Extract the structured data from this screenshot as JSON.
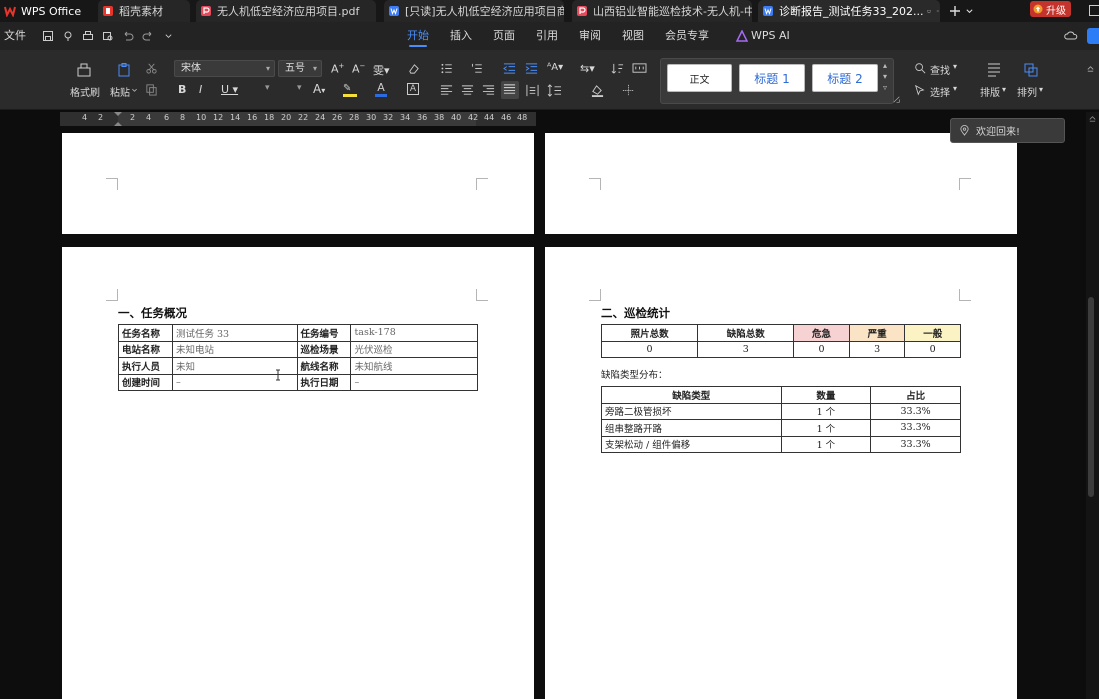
{
  "app": {
    "name": "WPS Office"
  },
  "tabs": [
    {
      "label": "WPS Office",
      "type": "wps"
    },
    {
      "label": "稻壳素材",
      "type": "docer"
    },
    {
      "label": "无人机低空经济应用项目.pdf",
      "type": "pdf"
    },
    {
      "label": "[只读]无人机低空经济应用项目商...",
      "type": "word"
    },
    {
      "label": "山西铝业智能巡检技术-无人机-中...",
      "type": "pdf"
    },
    {
      "label": "诊断报告_测试任务33_202...",
      "type": "word",
      "active": true
    }
  ],
  "upgrade_label": "升级",
  "menu": {
    "file": "文件",
    "items": [
      "开始",
      "插入",
      "页面",
      "引用",
      "审阅",
      "视图",
      "会员专享"
    ],
    "active": "开始",
    "ai": "WPS AI"
  },
  "ribbon": {
    "format_painter": "格式刷",
    "paste": "粘贴",
    "font_name": "宋体",
    "font_size": "五号",
    "styles": [
      "正文",
      "标题 1",
      "标题 2"
    ],
    "find": "查找",
    "select": "选择",
    "layout": "排版",
    "arrange": "排列"
  },
  "ruler_numbers": [
    "4",
    "2",
    "2",
    "4",
    "6",
    "8",
    "10",
    "12",
    "14",
    "16",
    "18",
    "20",
    "22",
    "24",
    "26",
    "28",
    "30",
    "32",
    "34",
    "36",
    "38",
    "40",
    "42",
    "44",
    "46",
    "48"
  ],
  "welcome": "欢迎回来!",
  "doc": {
    "section1": {
      "title": "一、任务概况",
      "rows": [
        [
          "任务名称",
          "测试任务 33",
          "任务编号",
          "task-178"
        ],
        [
          "电站名称",
          "未知电站",
          "巡检场景",
          "光伏巡检"
        ],
        [
          "执行人员",
          "未知",
          "航线名称",
          "未知航线"
        ],
        [
          "创建时间",
          "–",
          "执行日期",
          "–"
        ]
      ]
    },
    "section2": {
      "title": "二、巡检统计",
      "stats_headers": [
        "照片总数",
        "缺陷总数",
        "危急",
        "严重",
        "一般"
      ],
      "stats_values": [
        "0",
        "3",
        "0",
        "3",
        "0"
      ],
      "dist_label": "缺陷类型分布：",
      "dist_headers": [
        "缺陷类型",
        "数量",
        "占比"
      ],
      "dist_rows": [
        [
          "旁路二极管损坏",
          "1 个",
          "33.3%"
        ],
        [
          "组串整路开路",
          "1 个",
          "33.3%"
        ],
        [
          "支架松动 / 组件偏移",
          "1 个",
          "33.3%"
        ]
      ]
    }
  },
  "colors": {
    "critical_bg": "#f7d2d2",
    "serious_bg": "#fbe3c6",
    "general_bg": "#fbf3c4",
    "accent": "#4a8df8"
  }
}
